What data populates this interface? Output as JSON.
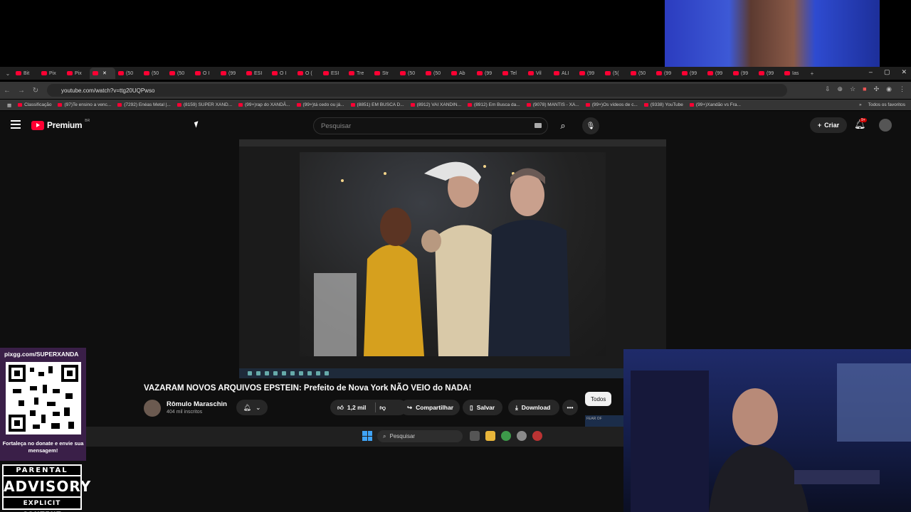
{
  "browser": {
    "tabs": [
      "Bit",
      "Pix",
      "Pix",
      "",
      "(50",
      "(50",
      "(50",
      "O I",
      "(99",
      "ESI",
      "O I",
      "O (",
      "ESI",
      "Tre",
      "Str",
      "(50",
      "(50",
      "Ab",
      "(99",
      "Tel",
      "Vil",
      "ALI",
      "(99",
      "(5(",
      "(50",
      "(99",
      "(99",
      "(99",
      "(99",
      "(99",
      "Ias"
    ],
    "new_tab": "+",
    "window_controls": [
      "–",
      "▢",
      "✕"
    ],
    "url": "youtube.com/watch?v=ttg20UQPwso",
    "bookmarks": [
      "Classificação",
      "(97)Te ensino a venc...",
      "(7292) Enéas Metal |...",
      "(8159) SUPER XAND...",
      "(99+)rap do XANDÃ...",
      "(99+)tá cedo ou já...",
      "(8851) EM BUSCA D...",
      "(8912) VAI XANDIN...",
      "(8912) Em Busca da...",
      "(9078) MANTIS - XA...",
      "(99+)Os vídeos de c...",
      "(9338) YouTube",
      "(99+)Xandão vs Fra..."
    ],
    "bookmarks_more": "»",
    "all_favorites": "Todos os favoritos"
  },
  "youtube": {
    "logo_text": "Premium",
    "logo_cc": "BR",
    "search_placeholder": "Pesquisar",
    "create_label": "Criar",
    "notif_count": "9+",
    "video_title": "VAZARAM NOVOS ARQUIVOS EPSTEIN: Prefeito de Nova York NÃO VEIO do NADA!",
    "channel_name": "Rômulo Maraschin",
    "subscribers": "404 mil inscritos",
    "likes": "1,2 mil",
    "share_label": "Compartilhar",
    "save_label": "Salvar",
    "download_label": "Download",
    "more_label": "•••",
    "chip_all": "Todos",
    "mini_thumb_text": "FEAR OF"
  },
  "os": {
    "search_label": "Pesquisar"
  },
  "overlay": {
    "pix_url": "pixgg.com/SUPERXANDA",
    "pix_message": "Fortaleça no donate e envie sua mensagem!",
    "advisory_top": "PARENTAL",
    "advisory_mid": "ADVISORY",
    "advisory_bot": "EXPLICIT CONTENT"
  },
  "colors": {
    "youtube_red": "#ff0033",
    "page_bg": "#0f0f0f",
    "pill_bg": "#272727"
  }
}
